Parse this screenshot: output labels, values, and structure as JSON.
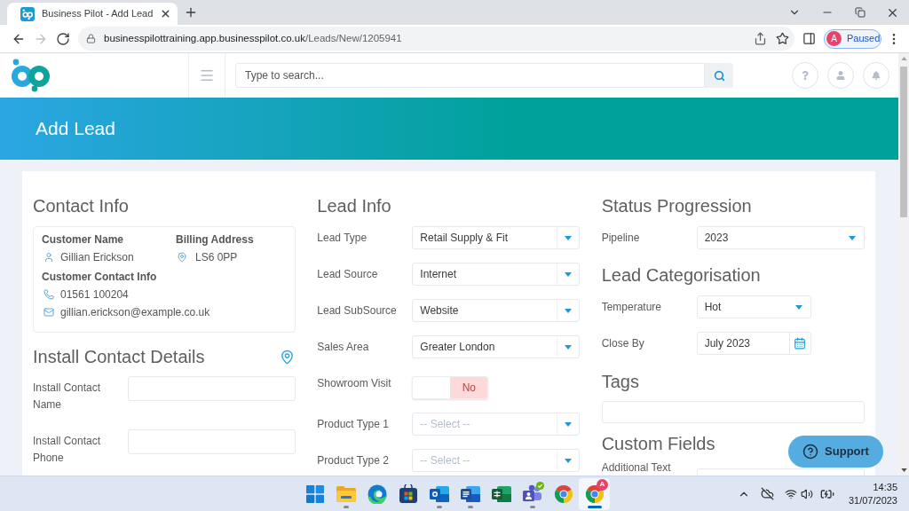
{
  "browser": {
    "tabs": [
      {
        "title": "Business Pilot - Add Lead",
        "selected": true
      }
    ],
    "navigation": [
      {
        "kind": "back",
        "disabled": false
      },
      {
        "kind": "forward",
        "disabled": true
      },
      {
        "kind": "reload",
        "disabled": false
      }
    ],
    "url": {
      "host": "businesspilottraining.app.businesspilot.co.uk",
      "path": "/Leads/New/1205941"
    },
    "profile": {
      "initial": "A",
      "status": "Paused"
    }
  },
  "header": {
    "search": {
      "placeholder": "Type to search..."
    }
  },
  "page_title": "Add Lead",
  "contact_info": {
    "heading": "Contact Info",
    "customer_name_label": "Customer Name",
    "customer_name": "Gillian Erickson",
    "billing_address_label": "Billing Address",
    "billing_address": "LS6 0PP",
    "contact_label": "Customer Contact Info",
    "phone": "01561 100204",
    "email": "gillian.erickson@example.co.uk"
  },
  "install_contact": {
    "heading": "Install Contact Details",
    "fields": [
      {
        "label": "Install Contact Name"
      },
      {
        "label": "Install Contact Phone"
      }
    ]
  },
  "lead_info": {
    "heading": "Lead Info",
    "fields": [
      {
        "kind": "select",
        "label": "Lead Type",
        "value": "Retail Supply & Fit"
      },
      {
        "kind": "select",
        "label": "Lead Source",
        "value": "Internet"
      },
      {
        "kind": "select",
        "label": "Lead SubSource",
        "value": "Website"
      },
      {
        "kind": "select",
        "label": "Sales Area",
        "value": "Greater London"
      },
      {
        "kind": "toggle",
        "label": "Showroom Visit",
        "on": false,
        "text": "No"
      },
      {
        "kind": "select",
        "label": "Product Type 1",
        "placeholder": "-- Select --"
      },
      {
        "kind": "select",
        "label": "Product Type 2",
        "placeholder": "-- Select --"
      }
    ]
  },
  "status_progression": {
    "heading": "Status Progression",
    "fields": [
      {
        "kind": "select",
        "label": "Pipeline",
        "value": "2023"
      }
    ]
  },
  "lead_categorisation": {
    "heading": "Lead Categorisation",
    "fields": [
      {
        "kind": "select",
        "label": "Temperature",
        "value": "Hot"
      },
      {
        "kind": "date",
        "label": "Close By",
        "value": "July 2023"
      }
    ]
  },
  "tags": {
    "heading": "Tags"
  },
  "custom_fields": {
    "heading": "Custom Fields",
    "fields": [
      {
        "kind": "text",
        "label": "Additional Text"
      }
    ]
  },
  "support_button": {
    "label": "Support"
  },
  "taskbar": {
    "apps": [
      {
        "kind": "start",
        "running": false,
        "selected": false
      },
      {
        "kind": "explorer",
        "running": true,
        "selected": false
      },
      {
        "kind": "edge",
        "running": false,
        "selected": false
      },
      {
        "kind": "store",
        "running": false,
        "selected": false
      },
      {
        "kind": "outlook",
        "running": true,
        "selected": false
      },
      {
        "kind": "word",
        "running": true,
        "selected": false
      },
      {
        "kind": "excel",
        "running": false,
        "selected": false
      },
      {
        "kind": "teams",
        "running": true,
        "selected": false
      },
      {
        "kind": "chrome",
        "running": false,
        "selected": false
      },
      {
        "kind": "chrome",
        "running": true,
        "selected": true,
        "badge": "A"
      }
    ],
    "clock": {
      "time": "14:35",
      "date": "31/07/2023"
    }
  }
}
